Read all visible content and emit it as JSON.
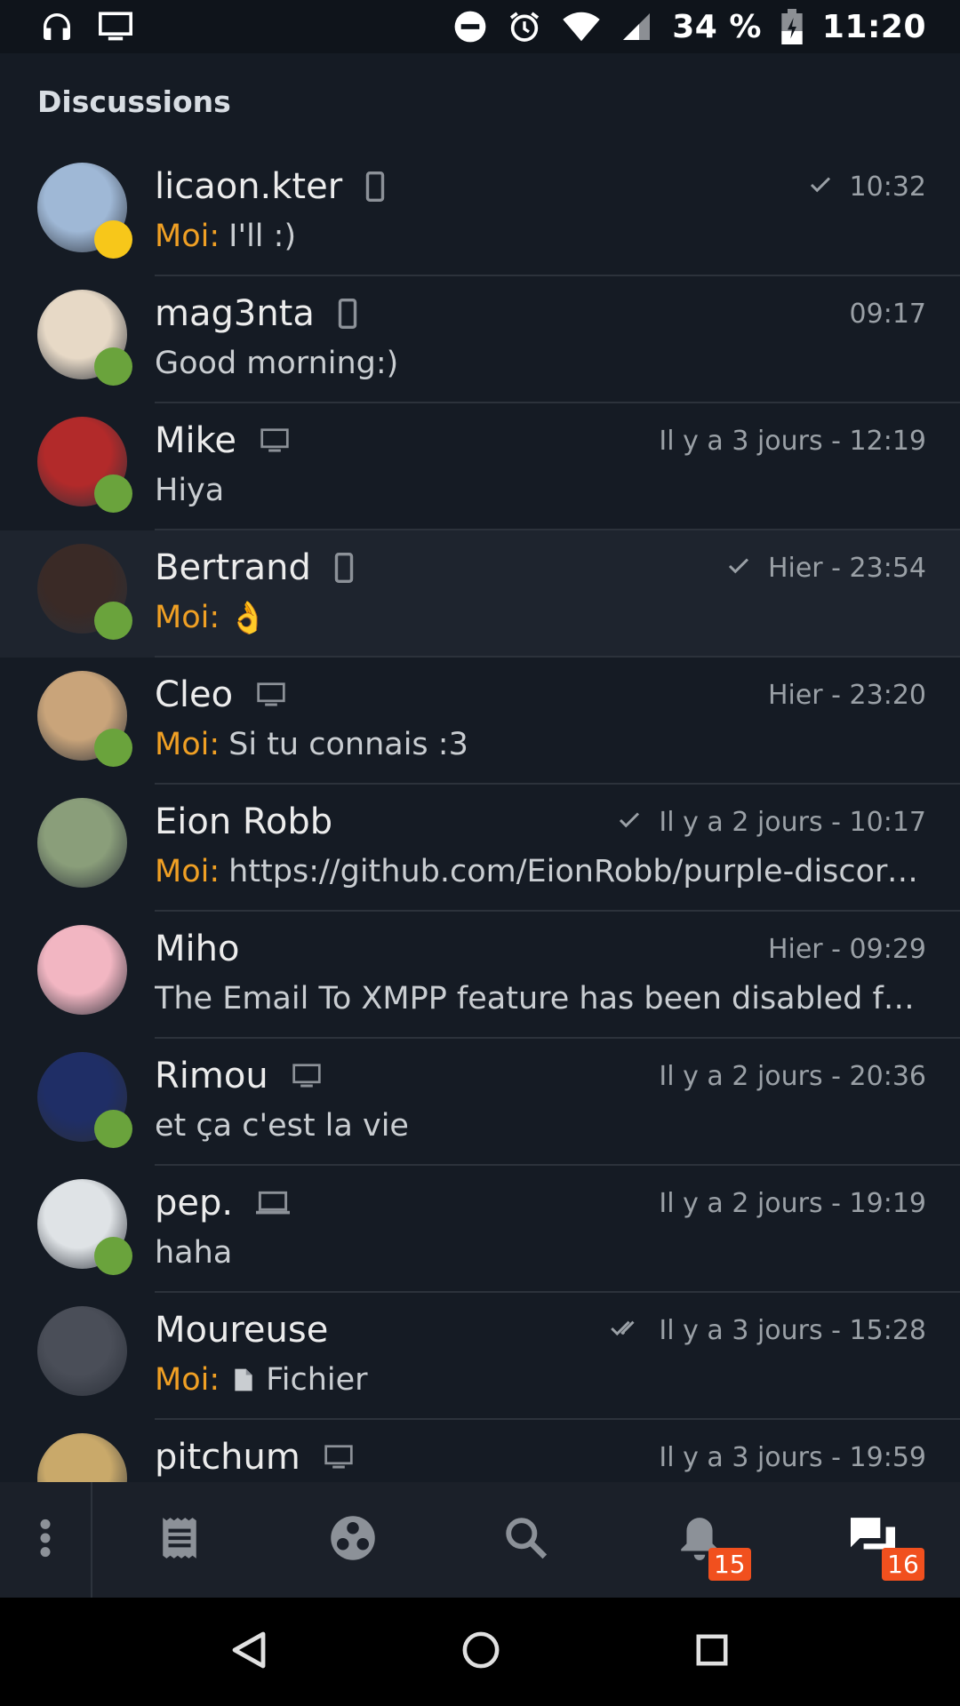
{
  "status_bar": {
    "battery": "34 %",
    "time": "11:20",
    "left_icons": [
      "headphones-icon",
      "desktop-icon"
    ],
    "right_icons": [
      "do-not-disturb-icon",
      "alarm-icon",
      "wifi-icon",
      "signal-icon",
      "battery-icon"
    ]
  },
  "header": {
    "title": "Discussions"
  },
  "conversations": [
    {
      "name": "licaon.kter",
      "device": "phone",
      "time": "10:32",
      "receipt": "sent",
      "me_label": "Moi:",
      "message": "I'll :)",
      "presence": "away",
      "avatar_color": "#9fb8d6"
    },
    {
      "name": "mag3nta",
      "device": "phone",
      "time": "09:17",
      "receipt": "",
      "me_label": "",
      "message": "Good morning:)",
      "presence": "online",
      "avatar_color": "#e7d9c6"
    },
    {
      "name": "Mike",
      "device": "desktop",
      "time": "Il y a 3 jours - 12:19",
      "receipt": "",
      "me_label": "",
      "message": "Hiya",
      "presence": "online",
      "avatar_color": "#b22a2a"
    },
    {
      "name": "Bertrand",
      "device": "phone",
      "time": "Hier - 23:54",
      "receipt": "sent",
      "me_label": "Moi:",
      "message": "👌",
      "presence": "online",
      "avatar_color": "#3a2a26",
      "highlight": true
    },
    {
      "name": "Cleo",
      "device": "desktop",
      "time": "Hier - 23:20",
      "receipt": "",
      "me_label": "Moi:",
      "message": "Si tu connais :3",
      "presence": "online",
      "avatar_color": "#c9a47a"
    },
    {
      "name": "Eion Robb",
      "device": "",
      "time": "Il y a 2 jours - 10:17",
      "receipt": "sent",
      "me_label": "Moi:",
      "message": "https://github.com/EionRobb/purple-discord…",
      "presence": "",
      "avatar_color": "#8a9e7a"
    },
    {
      "name": "Miho",
      "device": "",
      "time": "Hier - 09:29",
      "receipt": "",
      "me_label": "",
      "message": "The Email To XMPP feature has been disabled for …",
      "presence": "",
      "avatar_color": "#f2b6c2"
    },
    {
      "name": "Rimou",
      "device": "desktop",
      "time": "Il y a 2 jours - 20:36",
      "receipt": "",
      "me_label": "",
      "message": "et ça c'est la vie",
      "presence": "online",
      "avatar_color": "#1f2e66"
    },
    {
      "name": "pep.",
      "device": "laptop",
      "time": "Il y a 2 jours - 19:19",
      "receipt": "",
      "me_label": "",
      "message": "haha",
      "presence": "online",
      "avatar_color": "#dfe3e6"
    },
    {
      "name": "Moureuse",
      "device": "",
      "time": "Il y a 3 jours - 15:28",
      "receipt": "read",
      "me_label": "Moi:",
      "message": "Fichier",
      "file": true,
      "presence": "",
      "avatar_color": "#4a4e58"
    },
    {
      "name": "pitchum",
      "device": "desktop",
      "time": "Il y a 3 jours - 19:59",
      "receipt": "",
      "me_label": "",
      "message": "",
      "presence": "",
      "avatar_color": "#c9a96a"
    }
  ],
  "bottom_nav": {
    "items": [
      {
        "icon": "menu-dots-icon"
      },
      {
        "icon": "news-icon"
      },
      {
        "icon": "communities-icon"
      },
      {
        "icon": "search-icon"
      },
      {
        "icon": "notifications-icon",
        "badge": "15"
      },
      {
        "icon": "chats-icon",
        "badge": "16",
        "active": true
      }
    ]
  },
  "android_nav": {
    "icons": [
      "back-icon",
      "home-icon",
      "recents-icon"
    ]
  }
}
